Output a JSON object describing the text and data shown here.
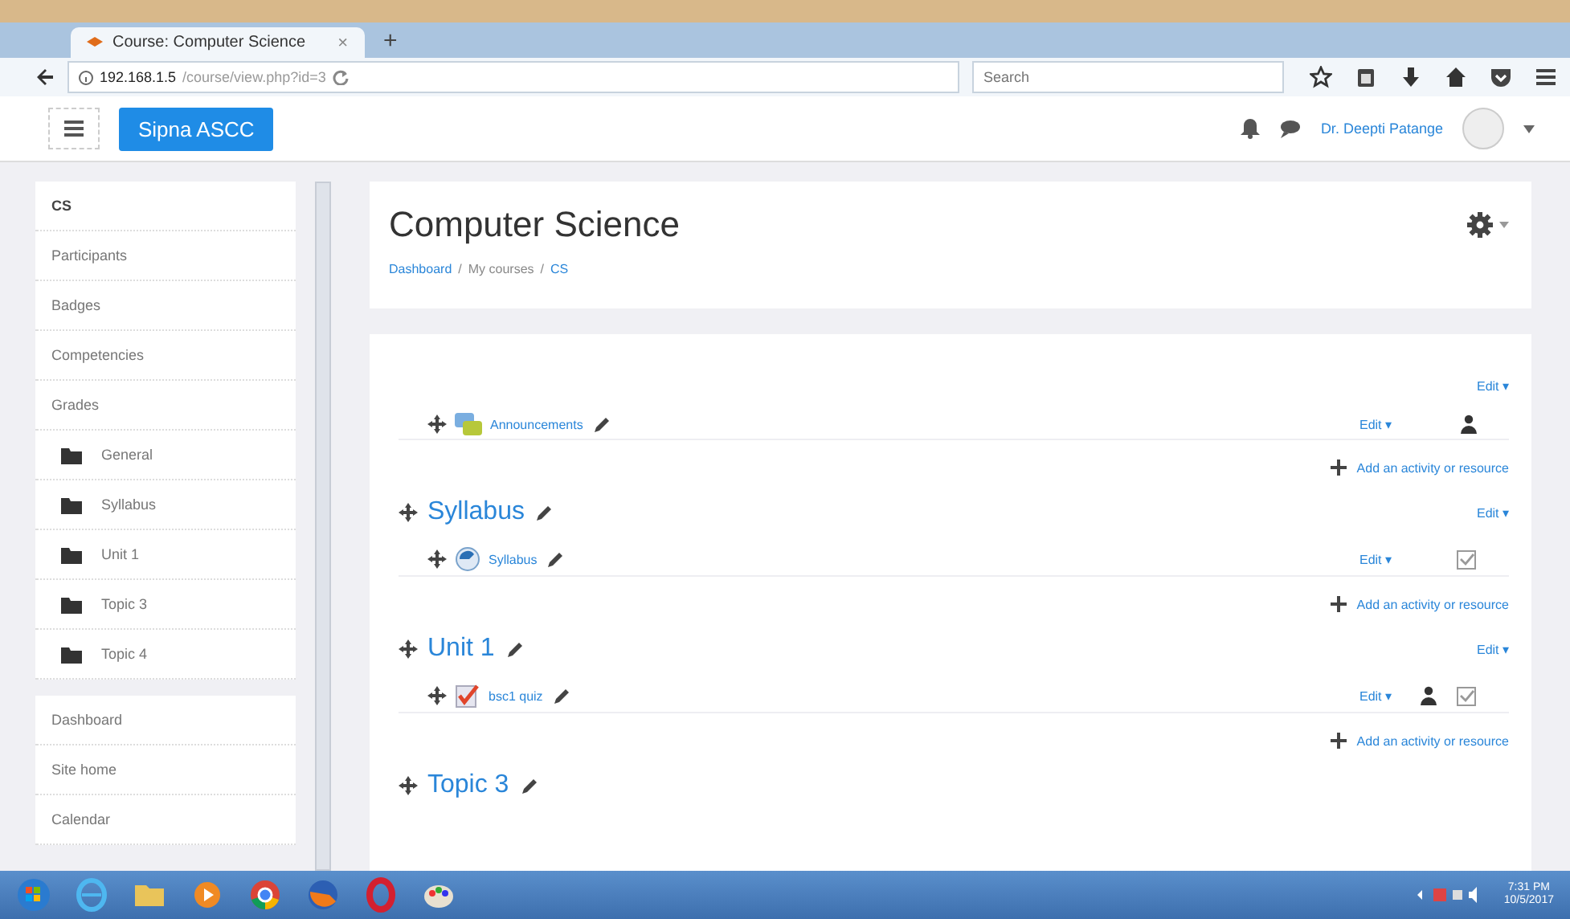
{
  "browser": {
    "tab": {
      "title": "Course: Computer Science",
      "close": "×",
      "selected": true
    },
    "new_tab": "+",
    "url": {
      "host": "192.168.1.5",
      "path": "/course/view.php?id=3"
    },
    "search": {
      "placeholder": "Search"
    }
  },
  "navbar": {
    "site_name": "Sipna ASCC",
    "user_name": "Dr. Deepti Patange"
  },
  "sidebar": {
    "course": [
      {
        "label": "CS",
        "kind": "heading"
      },
      {
        "label": "Participants",
        "kind": "link"
      },
      {
        "label": "Badges",
        "kind": "link"
      },
      {
        "label": "Competencies",
        "kind": "link"
      },
      {
        "label": "Grades",
        "kind": "link"
      },
      {
        "label": "General",
        "kind": "section"
      },
      {
        "label": "Syllabus",
        "kind": "section"
      },
      {
        "label": "Unit 1",
        "kind": "section"
      },
      {
        "label": "Topic 3",
        "kind": "section"
      },
      {
        "label": "Topic 4",
        "kind": "section"
      }
    ],
    "site": [
      {
        "label": "Dashboard",
        "kind": "link"
      },
      {
        "label": "Site home",
        "kind": "link"
      },
      {
        "label": "Calendar",
        "kind": "link"
      }
    ]
  },
  "course": {
    "title": "Computer Science",
    "separator": "/",
    "breadcrumb": [
      {
        "label": "Dashboard",
        "link": true
      },
      {
        "label": "My courses",
        "link": false
      },
      {
        "label": "CS",
        "link": true
      }
    ],
    "sections": [
      {
        "edit": "Edit ▾",
        "activities": [
          {
            "name": "Announcements",
            "kind": "forum",
            "edit": "Edit ▾",
            "groups": true,
            "completion": false
          }
        ],
        "add": "Add an activity or resource"
      },
      {
        "title": "Syllabus",
        "edit": "Edit ▾",
        "activities": [
          {
            "name": "Syllabus",
            "kind": "url",
            "edit": "Edit ▾",
            "groups": false,
            "completion": true
          }
        ],
        "add": "Add an activity or resource"
      },
      {
        "title": "Unit 1",
        "edit": "Edit ▾",
        "activities": [
          {
            "name": "bsc1 quiz",
            "kind": "quiz",
            "edit": "Edit ▾",
            "groups": true,
            "completion": true
          }
        ],
        "add": "Add an activity or resource"
      },
      {
        "title": "Topic 3"
      }
    ]
  },
  "taskbar": {
    "time": "7:31 PM",
    "date": "10/5/2017"
  }
}
